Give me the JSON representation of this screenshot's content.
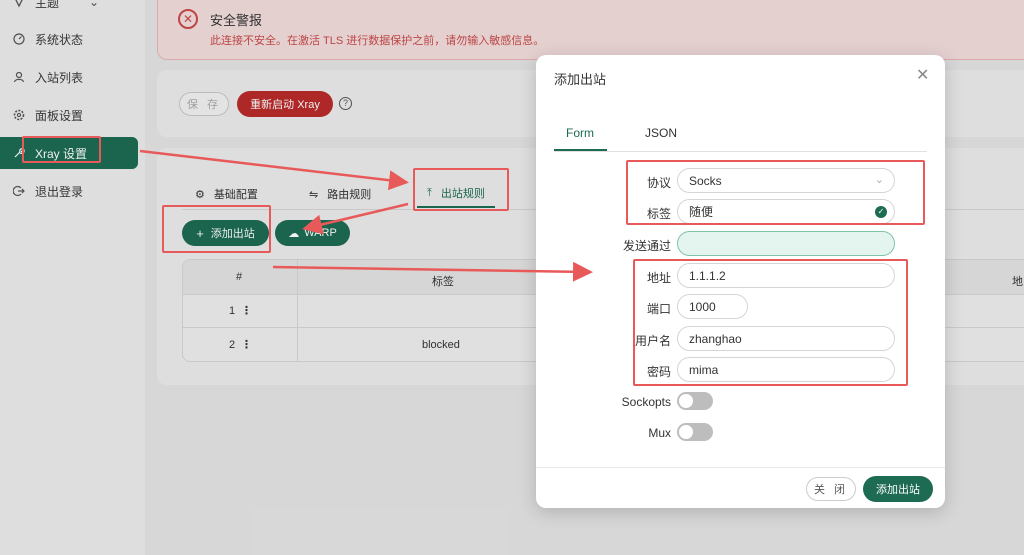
{
  "sidebar": {
    "items": [
      {
        "label": "主题",
        "icon": "theme-icon"
      },
      {
        "label": "系统状态",
        "icon": "dashboard-icon"
      },
      {
        "label": "入站列表",
        "icon": "user-icon"
      },
      {
        "label": "面板设置",
        "icon": "settings-icon"
      },
      {
        "label": "Xray 设置",
        "icon": "tool-icon"
      },
      {
        "label": "退出登录",
        "icon": "logout-icon"
      }
    ]
  },
  "alert": {
    "title": "安全警报",
    "text": "此连接不安全。在激活 TLS 进行数据保护之前，请勿输入敏感信息。"
  },
  "toolbar": {
    "save_label": "保 存",
    "restart_label": "重新启动 Xray"
  },
  "tabs": {
    "basic": "基础配置",
    "routing": "路由规则",
    "outbound": "出站规则"
  },
  "actions": {
    "add_outbound": "添加出站",
    "warp": "WARP"
  },
  "table": {
    "headers": {
      "index": "#",
      "tag": "标签",
      "addr": "地"
    },
    "rows": [
      {
        "index": "1",
        "tag": ""
      },
      {
        "index": "2",
        "tag": "blocked"
      }
    ]
  },
  "modal": {
    "title": "添加出站",
    "tabs": {
      "form": "Form",
      "json": "JSON"
    },
    "fields": {
      "protocol_label": "协议",
      "protocol_value": "Socks",
      "tag_label": "标签",
      "tag_value": "随便",
      "sendthrough_label": "发送通过",
      "sendthrough_value": "",
      "address_label": "地址",
      "address_value": "1.1.1.2",
      "port_label": "端口",
      "port_value": "1000",
      "username_label": "用户名",
      "username_value": "zhanghao",
      "password_label": "密码",
      "password_value": "mima",
      "sockopts_label": "Sockopts",
      "mux_label": "Mux"
    },
    "close_label": "关 闭",
    "confirm_label": "添加出站"
  },
  "colors": {
    "primary": "#1d6b52",
    "danger": "#b92b2b",
    "annotation": "#e85a5a"
  }
}
